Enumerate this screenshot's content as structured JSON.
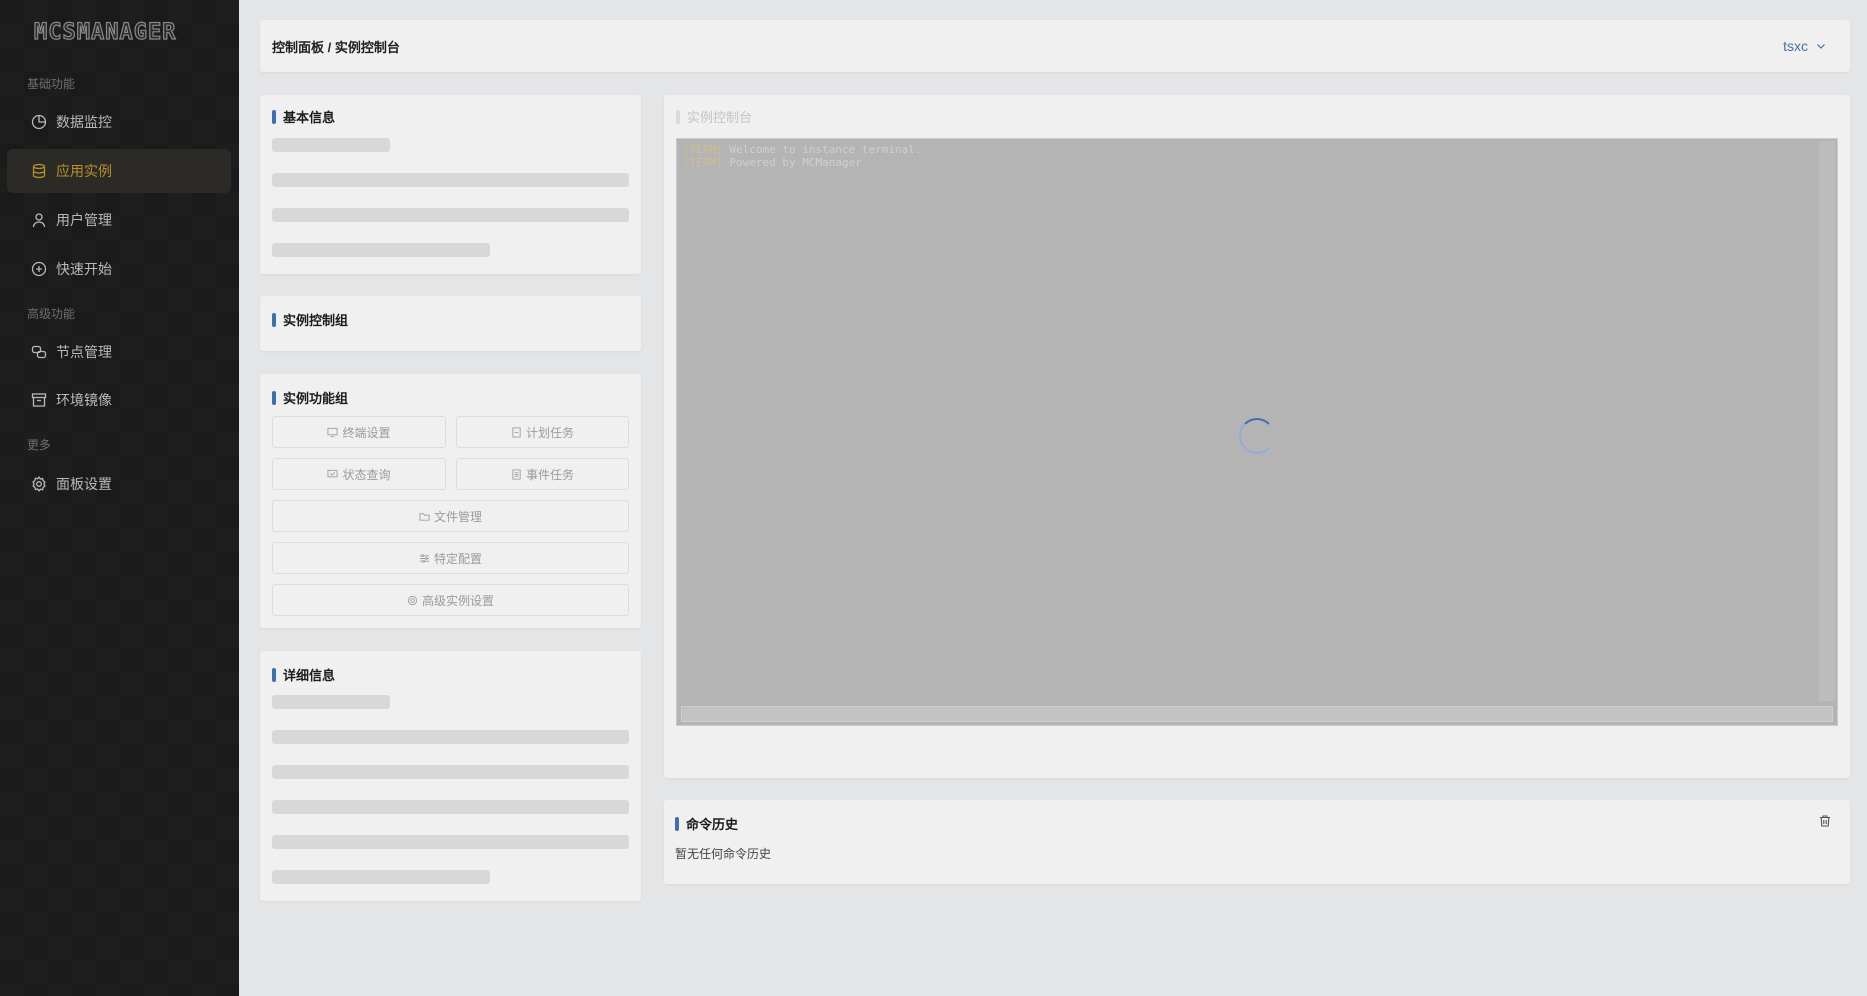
{
  "logo": "MCSMANAGER",
  "sidebar": {
    "sections": [
      {
        "title": "基础功能"
      },
      {
        "title": "高级功能"
      },
      {
        "title": "更多"
      }
    ],
    "items": [
      {
        "label": "数据监控",
        "icon": "pie-chart-icon"
      },
      {
        "label": "应用实例",
        "icon": "database-icon",
        "active": true
      },
      {
        "label": "用户管理",
        "icon": "user-icon"
      },
      {
        "label": "快速开始",
        "icon": "plus-circle-icon"
      },
      {
        "label": "节点管理",
        "icon": "nodes-icon"
      },
      {
        "label": "环境镜像",
        "icon": "archive-icon"
      },
      {
        "label": "面板设置",
        "icon": "gear-icon"
      }
    ]
  },
  "header": {
    "breadcrumb": "控制面板 / 实例控制台",
    "user": "tsxc"
  },
  "cards": {
    "basic_info": "基本信息",
    "control_group": "实例控制组",
    "function_group": "实例功能组",
    "detail_info": "详细信息",
    "console": "实例控制台",
    "history": "命令历史"
  },
  "functions": {
    "terminal_settings": "终端设置",
    "scheduled_tasks": "计划任务",
    "status_query": "状态查询",
    "event_tasks": "事件任务",
    "file_manager": "文件管理",
    "specific_config": "特定配置",
    "advanced_settings": "高级实例设置"
  },
  "terminal": {
    "lines": [
      {
        "tag": "[TERM]",
        "text": " Welcome to instance terminal."
      },
      {
        "tag": "[TERM]",
        "text": " Powered by MCManager"
      }
    ]
  },
  "history": {
    "empty": "暂无任何命令历史"
  },
  "colors": {
    "accent": "#3f6ea8",
    "active_nav": "#b8902a"
  }
}
